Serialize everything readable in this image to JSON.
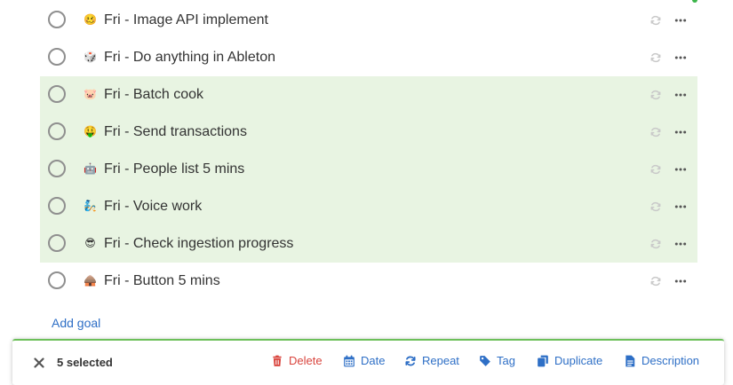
{
  "goals": [
    {
      "title": "Fri - Image API implement",
      "emoji": "🥴",
      "selected": false
    },
    {
      "title": "Fri - Do anything in Ableton",
      "emoji": "🎲",
      "selected": false
    },
    {
      "title": "Fri - Batch cook",
      "emoji": "🐷",
      "selected": true
    },
    {
      "title": "Fri - Send transactions",
      "emoji": "🤑",
      "selected": true
    },
    {
      "title": "Fri - People list 5 mins",
      "emoji": "🤖",
      "selected": true
    },
    {
      "title": "Fri - Voice work",
      "emoji": "🧞",
      "selected": true
    },
    {
      "title": "Fri - Check ingestion progress",
      "emoji": "😎",
      "selected": true
    },
    {
      "title": "Fri - Button 5 mins",
      "emoji": "🛖",
      "selected": false
    }
  ],
  "add_goal_label": "Add goal",
  "action_bar": {
    "selected_text": "5 selected",
    "delete_label": "Delete",
    "date_label": "Date",
    "repeat_label": "Repeat",
    "tag_label": "Tag",
    "duplicate_label": "Duplicate",
    "description_label": "Description"
  },
  "colors": {
    "selected_row": "#e8f4e2",
    "accent_blue": "#2e6fc6",
    "delete_red": "#d9443d",
    "bar_border_green": "#6bbf59"
  },
  "icons": {
    "row_repeat": "repeat-icon",
    "row_more": "more-options-icon",
    "close": "close-icon"
  }
}
